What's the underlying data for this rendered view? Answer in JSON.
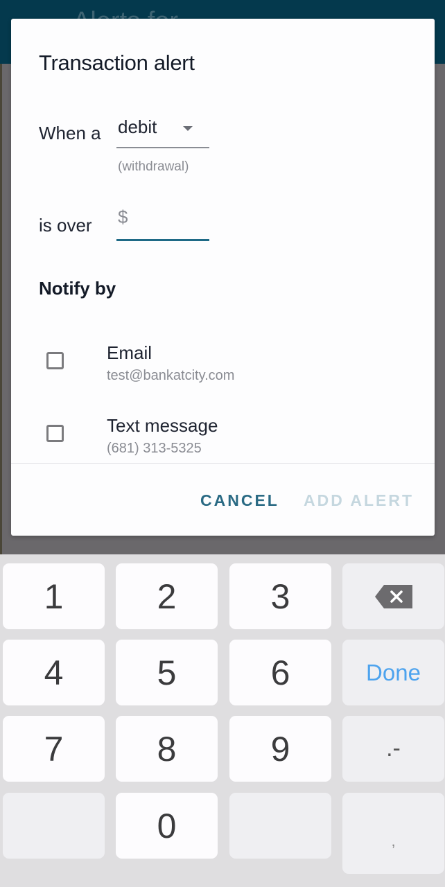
{
  "app": {
    "header_title": "Alerts for"
  },
  "dialog": {
    "title": "Transaction alert",
    "when_label": "When a",
    "transaction_type": {
      "selected": "debit",
      "helper": "(withdrawal)"
    },
    "amount": {
      "label": "is over",
      "prefix": "$",
      "value": "",
      "placeholder": ""
    },
    "notify_section_title": "Notify by",
    "notify_options": [
      {
        "label": "Email",
        "detail": "test@bankatcity.com",
        "checked": false
      },
      {
        "label": "Text message",
        "detail": "(681) 313-5325",
        "checked": false
      }
    ],
    "cancel_label": "CANCEL",
    "add_label": "ADD ALERT",
    "colors": {
      "accent": "#2a6a84",
      "disabled": "#c5d7df",
      "header": "#04394d"
    }
  },
  "keyboard": {
    "rows": [
      [
        "1",
        "2",
        "3",
        "backspace"
      ],
      [
        "4",
        "5",
        "6",
        "Done"
      ],
      [
        "7",
        "8",
        "9",
        ".-"
      ],
      [
        "",
        "0",
        "",
        ","
      ]
    ],
    "done_label": "Done",
    "symbol_key": ".-",
    "comma_key": ",",
    "backspace_icon": "backspace-icon",
    "done_color": "#4da3ee"
  }
}
